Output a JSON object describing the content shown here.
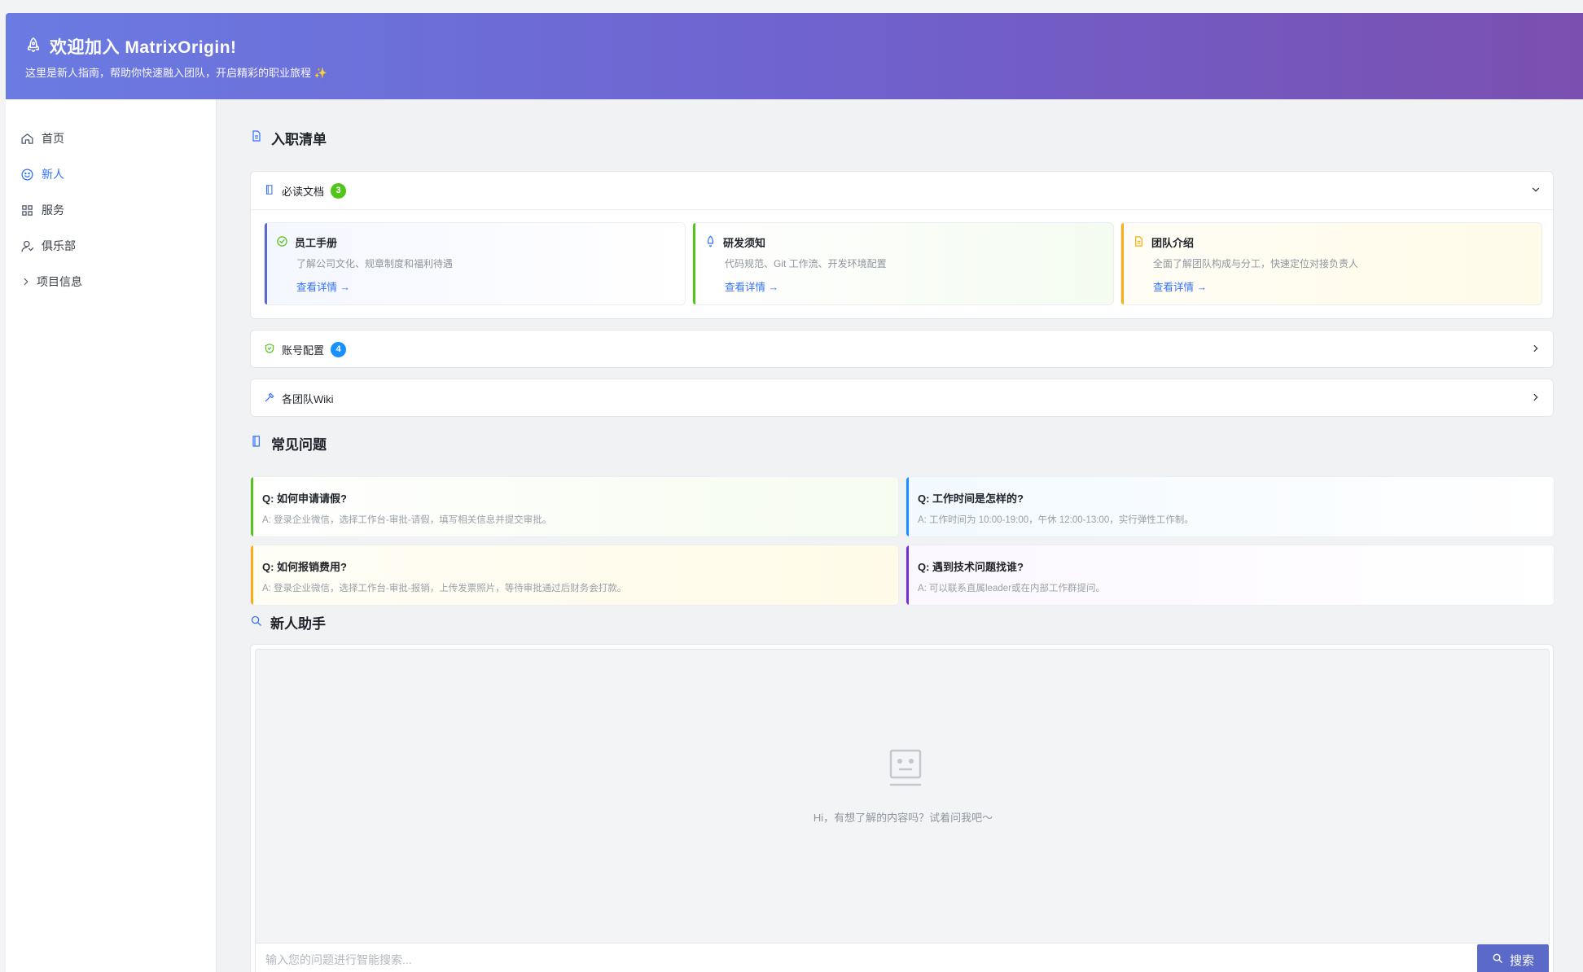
{
  "header": {
    "title": "欢迎加入 MatrixOrigin!",
    "subtitle": "这里是新人指南，帮助你快速融入团队，开启精彩的职业旅程 ✨"
  },
  "sidebar": {
    "items": [
      {
        "label": "首页",
        "icon": "home-icon"
      },
      {
        "label": "新人",
        "icon": "smile-icon",
        "active": true
      },
      {
        "label": "服务",
        "icon": "grid-icon"
      },
      {
        "label": "俱乐部",
        "icon": "user-icon"
      },
      {
        "label": "项目信息",
        "icon": "chevron-right-icon"
      }
    ]
  },
  "onboarding": {
    "title": "入职清单",
    "required_docs": {
      "label": "必读文档",
      "count": "3",
      "cards": [
        {
          "title": "员工手册",
          "desc": "了解公司文化、规章制度和福利待遇",
          "link": "查看详情 →"
        },
        {
          "title": "研发须知",
          "desc": "代码规范、Git 工作流、开发环境配置",
          "link": "查看详情 →"
        },
        {
          "title": "团队介绍",
          "desc": "全面了解团队构成与分工，快速定位对接负责人",
          "link": "查看详情 →"
        }
      ]
    },
    "account": {
      "label": "账号配置",
      "count": "4"
    },
    "wiki": {
      "label": "各团队Wiki"
    }
  },
  "faq": {
    "title": "常见问题",
    "items": [
      {
        "q": "Q: 如何申请请假?",
        "a": "A: 登录企业微信，选择工作台-审批-请假，填写相关信息并提交审批。"
      },
      {
        "q": "Q: 工作时间是怎样的?",
        "a": "A: 工作时间为 10:00-19:00，午休 12:00-13:00，实行弹性工作制。"
      },
      {
        "q": "Q: 如何报销费用?",
        "a": "A: 登录企业微信，选择工作台-审批-报销，上传发票照片，等待审批通过后财务会打款。"
      },
      {
        "q": "Q: 遇到技术问题找谁?",
        "a": "A: 可以联系直属leader或在内部工作群提问。"
      }
    ]
  },
  "assistant": {
    "title": "新人助手",
    "empty_text": "Hi，有想了解的内容吗？试着问我吧～",
    "placeholder": "输入您的问题进行智能搜索...",
    "search_label": "搜索"
  },
  "colors": {
    "accent": "#3370ff",
    "green": "#52c41a",
    "blue_badge": "#1890ff",
    "orange": "#faad14",
    "purple": "#722ed1",
    "search_btn": "#5b6ac8"
  }
}
